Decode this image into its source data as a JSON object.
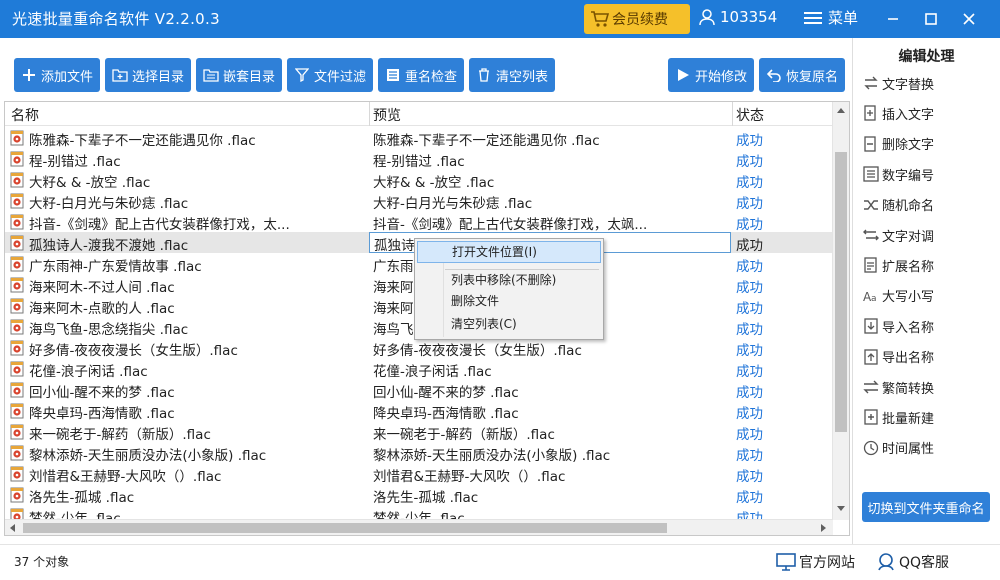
{
  "app": {
    "title": "光速批量重命名软件 V2.2.0.3",
    "vip_label": "会员续费",
    "user_id": "103354",
    "menu_label": "菜单"
  },
  "toolbar": {
    "add_file": "添加文件",
    "select_dir": "选择目录",
    "nested_dir": "嵌套目录",
    "file_filter": "文件过滤",
    "rename_check": "重名检查",
    "clear_list": "清空列表",
    "start_modify": "开始修改",
    "restore_name": "恢复原名"
  },
  "table": {
    "headers": {
      "name": "名称",
      "preview": "预览",
      "status": "状态"
    },
    "rows": [
      {
        "name": "陈雅森-下辈子不一定还能遇见你 .flac",
        "preview": "陈雅森-下辈子不一定还能遇见你 .flac",
        "status": "成功"
      },
      {
        "name": "程-别错过 .flac",
        "preview": "程-别错过 .flac",
        "status": "成功"
      },
      {
        "name": "大籽& & -放空 .flac",
        "preview": "大籽& & -放空 .flac",
        "status": "成功"
      },
      {
        "name": "大籽-白月光与朱砂痣 .flac",
        "preview": "大籽-白月光与朱砂痣 .flac",
        "status": "成功"
      },
      {
        "name": "抖音-《剑魂》配上古代女装群像打戏，太...",
        "preview": "抖音-《剑魂》配上古代女装群像打戏，太飒...",
        "status": "成功"
      },
      {
        "name": "孤独诗人-渡我不渡她 .flac",
        "preview": "孤独诗",
        "status": "成功",
        "selected": true
      },
      {
        "name": "广东雨神-广东爱情故事 .flac",
        "preview": "广东雨",
        "status": "成功"
      },
      {
        "name": "海来阿木-不过人间 .flac",
        "preview": "海来阿",
        "status": "成功"
      },
      {
        "name": "海来阿木-点歌的人 .flac",
        "preview": "海来阿",
        "status": "成功"
      },
      {
        "name": "海鸟飞鱼-思念绕指尖 .flac",
        "preview": "海鸟飞",
        "status": "成功"
      },
      {
        "name": "好多倩-夜夜夜漫长（女生版）.flac",
        "preview": "好多倩-夜夜夜漫长（女生版）.flac",
        "status": "成功"
      },
      {
        "name": "花僮-浪子闲话 .flac",
        "preview": "花僮-浪子闲话 .flac",
        "status": "成功"
      },
      {
        "name": "回小仙-醒不来的梦 .flac",
        "preview": "回小仙-醒不来的梦 .flac",
        "status": "成功"
      },
      {
        "name": "降央卓玛-西海情歌 .flac",
        "preview": "降央卓玛-西海情歌 .flac",
        "status": "成功"
      },
      {
        "name": "来一碗老于-解药（新版）.flac",
        "preview": "来一碗老于-解药（新版）.flac",
        "status": "成功"
      },
      {
        "name": "黎林添娇-天生丽质没办法(小象版) .flac",
        "preview": "黎林添娇-天生丽质没办法(小象版) .flac",
        "status": "成功"
      },
      {
        "name": "刘惜君&王赫野-大风吹（）.flac",
        "preview": "刘惜君&王赫野-大风吹（）.flac",
        "status": "成功"
      },
      {
        "name": "洛先生-孤城 .flac",
        "preview": "洛先生-孤城 .flac",
        "status": "成功"
      },
      {
        "name": "梦然-少年 .flac",
        "preview": "梦然-少年 .flac",
        "status": "成功"
      }
    ]
  },
  "context_menu": {
    "open_location": "打开文件位置(I)",
    "remove_from_list": "列表中移除(不删除)",
    "delete_file": "删除文件",
    "clear_list": "清空列表(C)"
  },
  "right_panel": {
    "heading": "编辑处理",
    "items": [
      {
        "label": "文字替换",
        "icon": "swap-icon"
      },
      {
        "label": "插入文字",
        "icon": "insert-icon"
      },
      {
        "label": "删除文字",
        "icon": "delete-text-icon"
      },
      {
        "label": "数字编号",
        "icon": "number-icon"
      },
      {
        "label": "随机命名",
        "icon": "shuffle-icon"
      },
      {
        "label": "文字对调",
        "icon": "exchange-icon"
      },
      {
        "label": "扩展名称",
        "icon": "extension-icon"
      },
      {
        "label": "大写小写",
        "icon": "case-icon"
      },
      {
        "label": "导入名称",
        "icon": "import-icon"
      },
      {
        "label": "导出名称",
        "icon": "export-icon"
      },
      {
        "label": "繁简转换",
        "icon": "convert-icon"
      },
      {
        "label": "批量新建",
        "icon": "batch-new-icon"
      },
      {
        "label": "时间属性",
        "icon": "clock-icon"
      }
    ],
    "switch_button": "切换到文件夹重命名"
  },
  "statusbar": {
    "count": "37 个对象",
    "website": "官方网站",
    "qq_service": "QQ客服"
  },
  "colors": {
    "title_bar": "#1f7bd8",
    "button_blue": "#2f80d8",
    "vip_yellow": "#f5c02a",
    "status_success": "#1f74d9"
  }
}
